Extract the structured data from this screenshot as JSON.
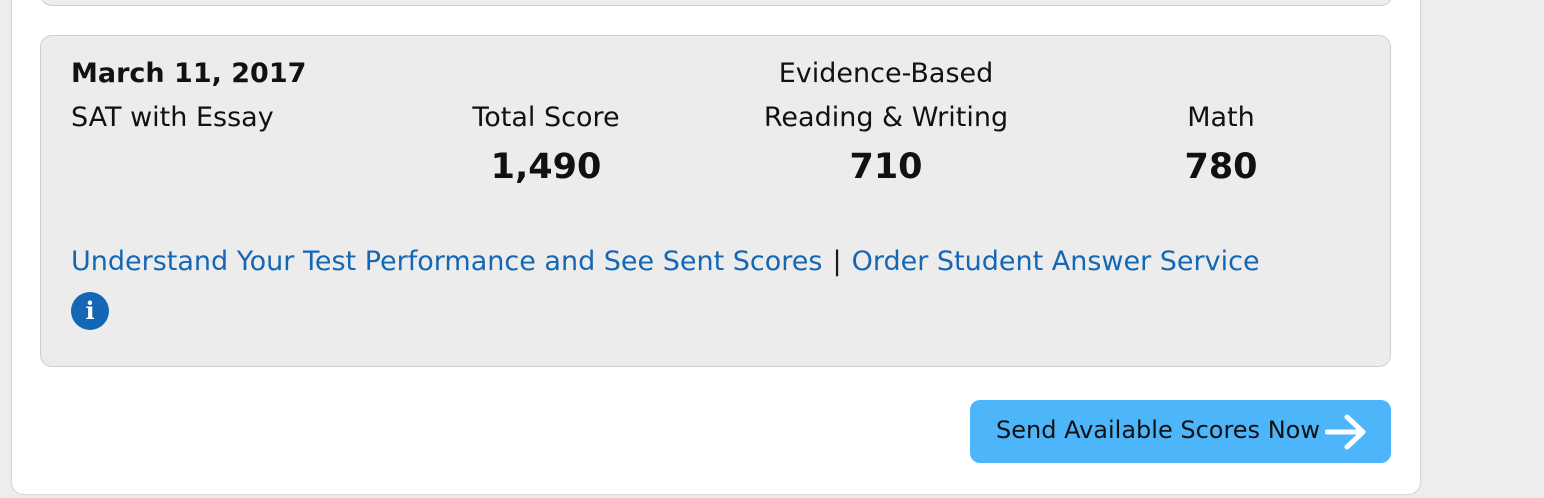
{
  "score_card": {
    "date": "March 11, 2017",
    "test_name": "SAT with Essay",
    "columns": [
      {
        "label_top": "",
        "label": "Total Score",
        "value": "1,490"
      },
      {
        "label_top": "Evidence-Based",
        "label": "Reading & Writing",
        "value": "710"
      },
      {
        "label_top": "",
        "label": "Math",
        "value": "780"
      }
    ],
    "links": {
      "performance": "Understand Your Test Performance and See Sent Scores",
      "separator": "|",
      "answer_service": "Order Student Answer Service"
    },
    "info_icon": "info-icon"
  },
  "actions": {
    "send_scores_label": "Send Available Scores Now",
    "send_scores_icon": "arrow-right-icon"
  },
  "colors": {
    "link": "#1467b5",
    "button": "#4db5fa",
    "card_bg": "#ececec"
  }
}
